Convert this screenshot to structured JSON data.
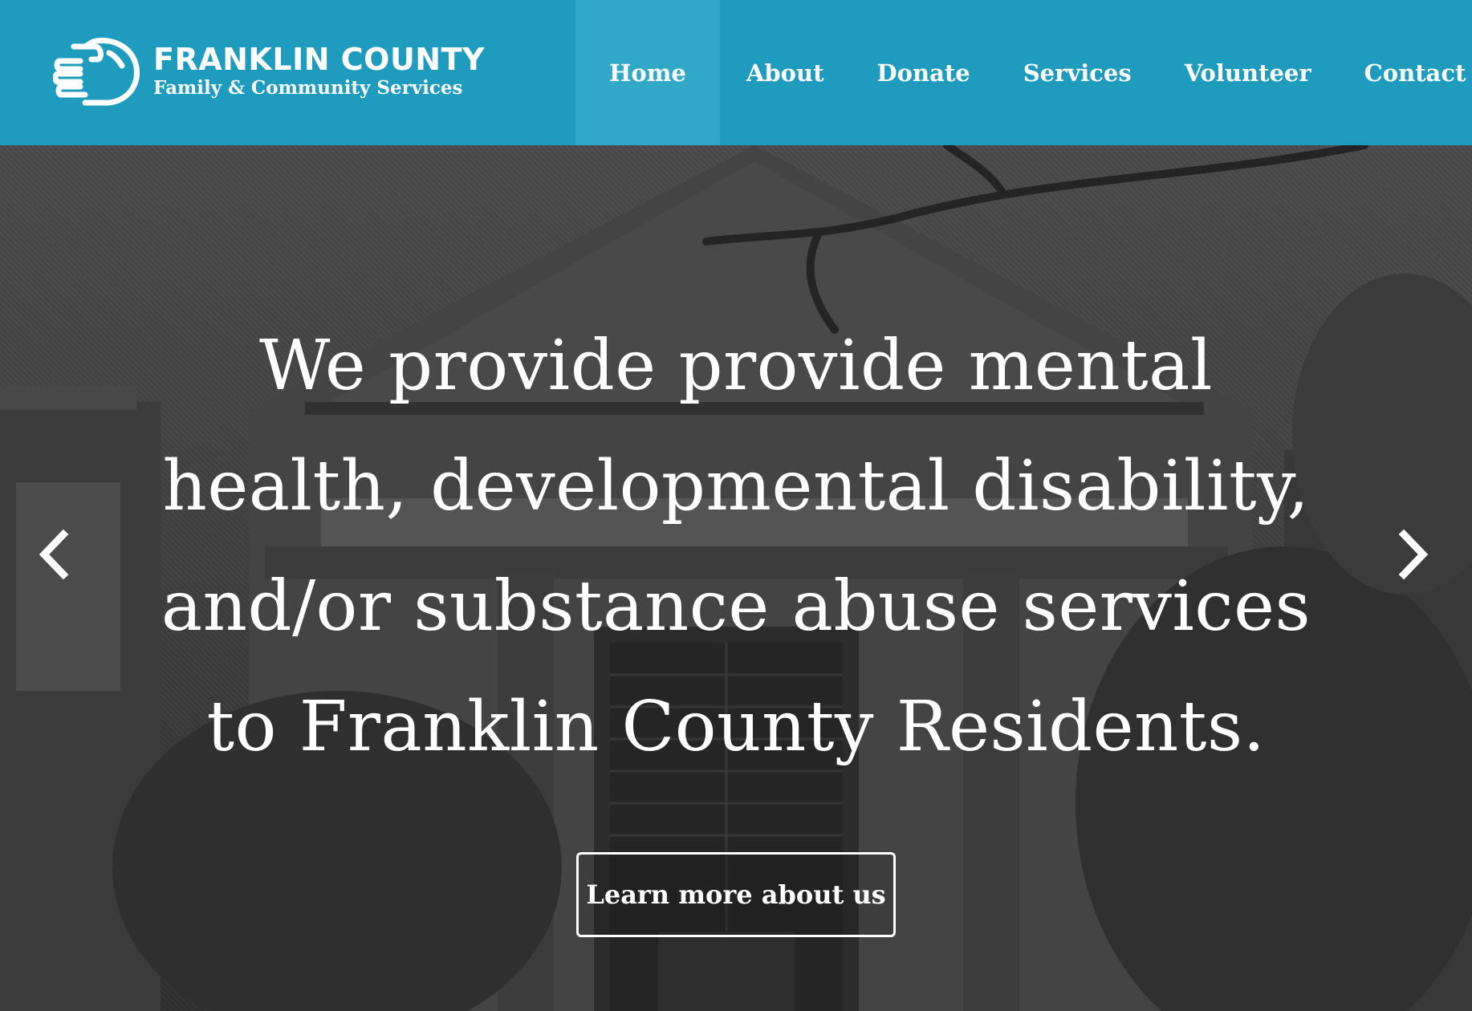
{
  "brand": {
    "title": "FRANKLIN COUNTY",
    "subtitle": "Family & Community Services",
    "logo_icon": "hand-icon"
  },
  "nav": {
    "active": "Home",
    "items": [
      {
        "label": "Home"
      },
      {
        "label": "About"
      },
      {
        "label": "Donate"
      },
      {
        "label": "Services"
      },
      {
        "label": "Volunteer"
      },
      {
        "label": "Contact"
      }
    ]
  },
  "hero": {
    "lines": [
      "We provide provide mental",
      "health, developmental disability,",
      "and/or substance abuse services",
      "to Franklin County Residents."
    ],
    "cta_label": "Learn more about us",
    "prev_icon": "chevron-left-icon",
    "next_icon": "chevron-right-icon"
  },
  "colors": {
    "header_bg": "#1e9bbd",
    "nav_active_bg": "#31a8c7",
    "text": "#ffffff"
  }
}
